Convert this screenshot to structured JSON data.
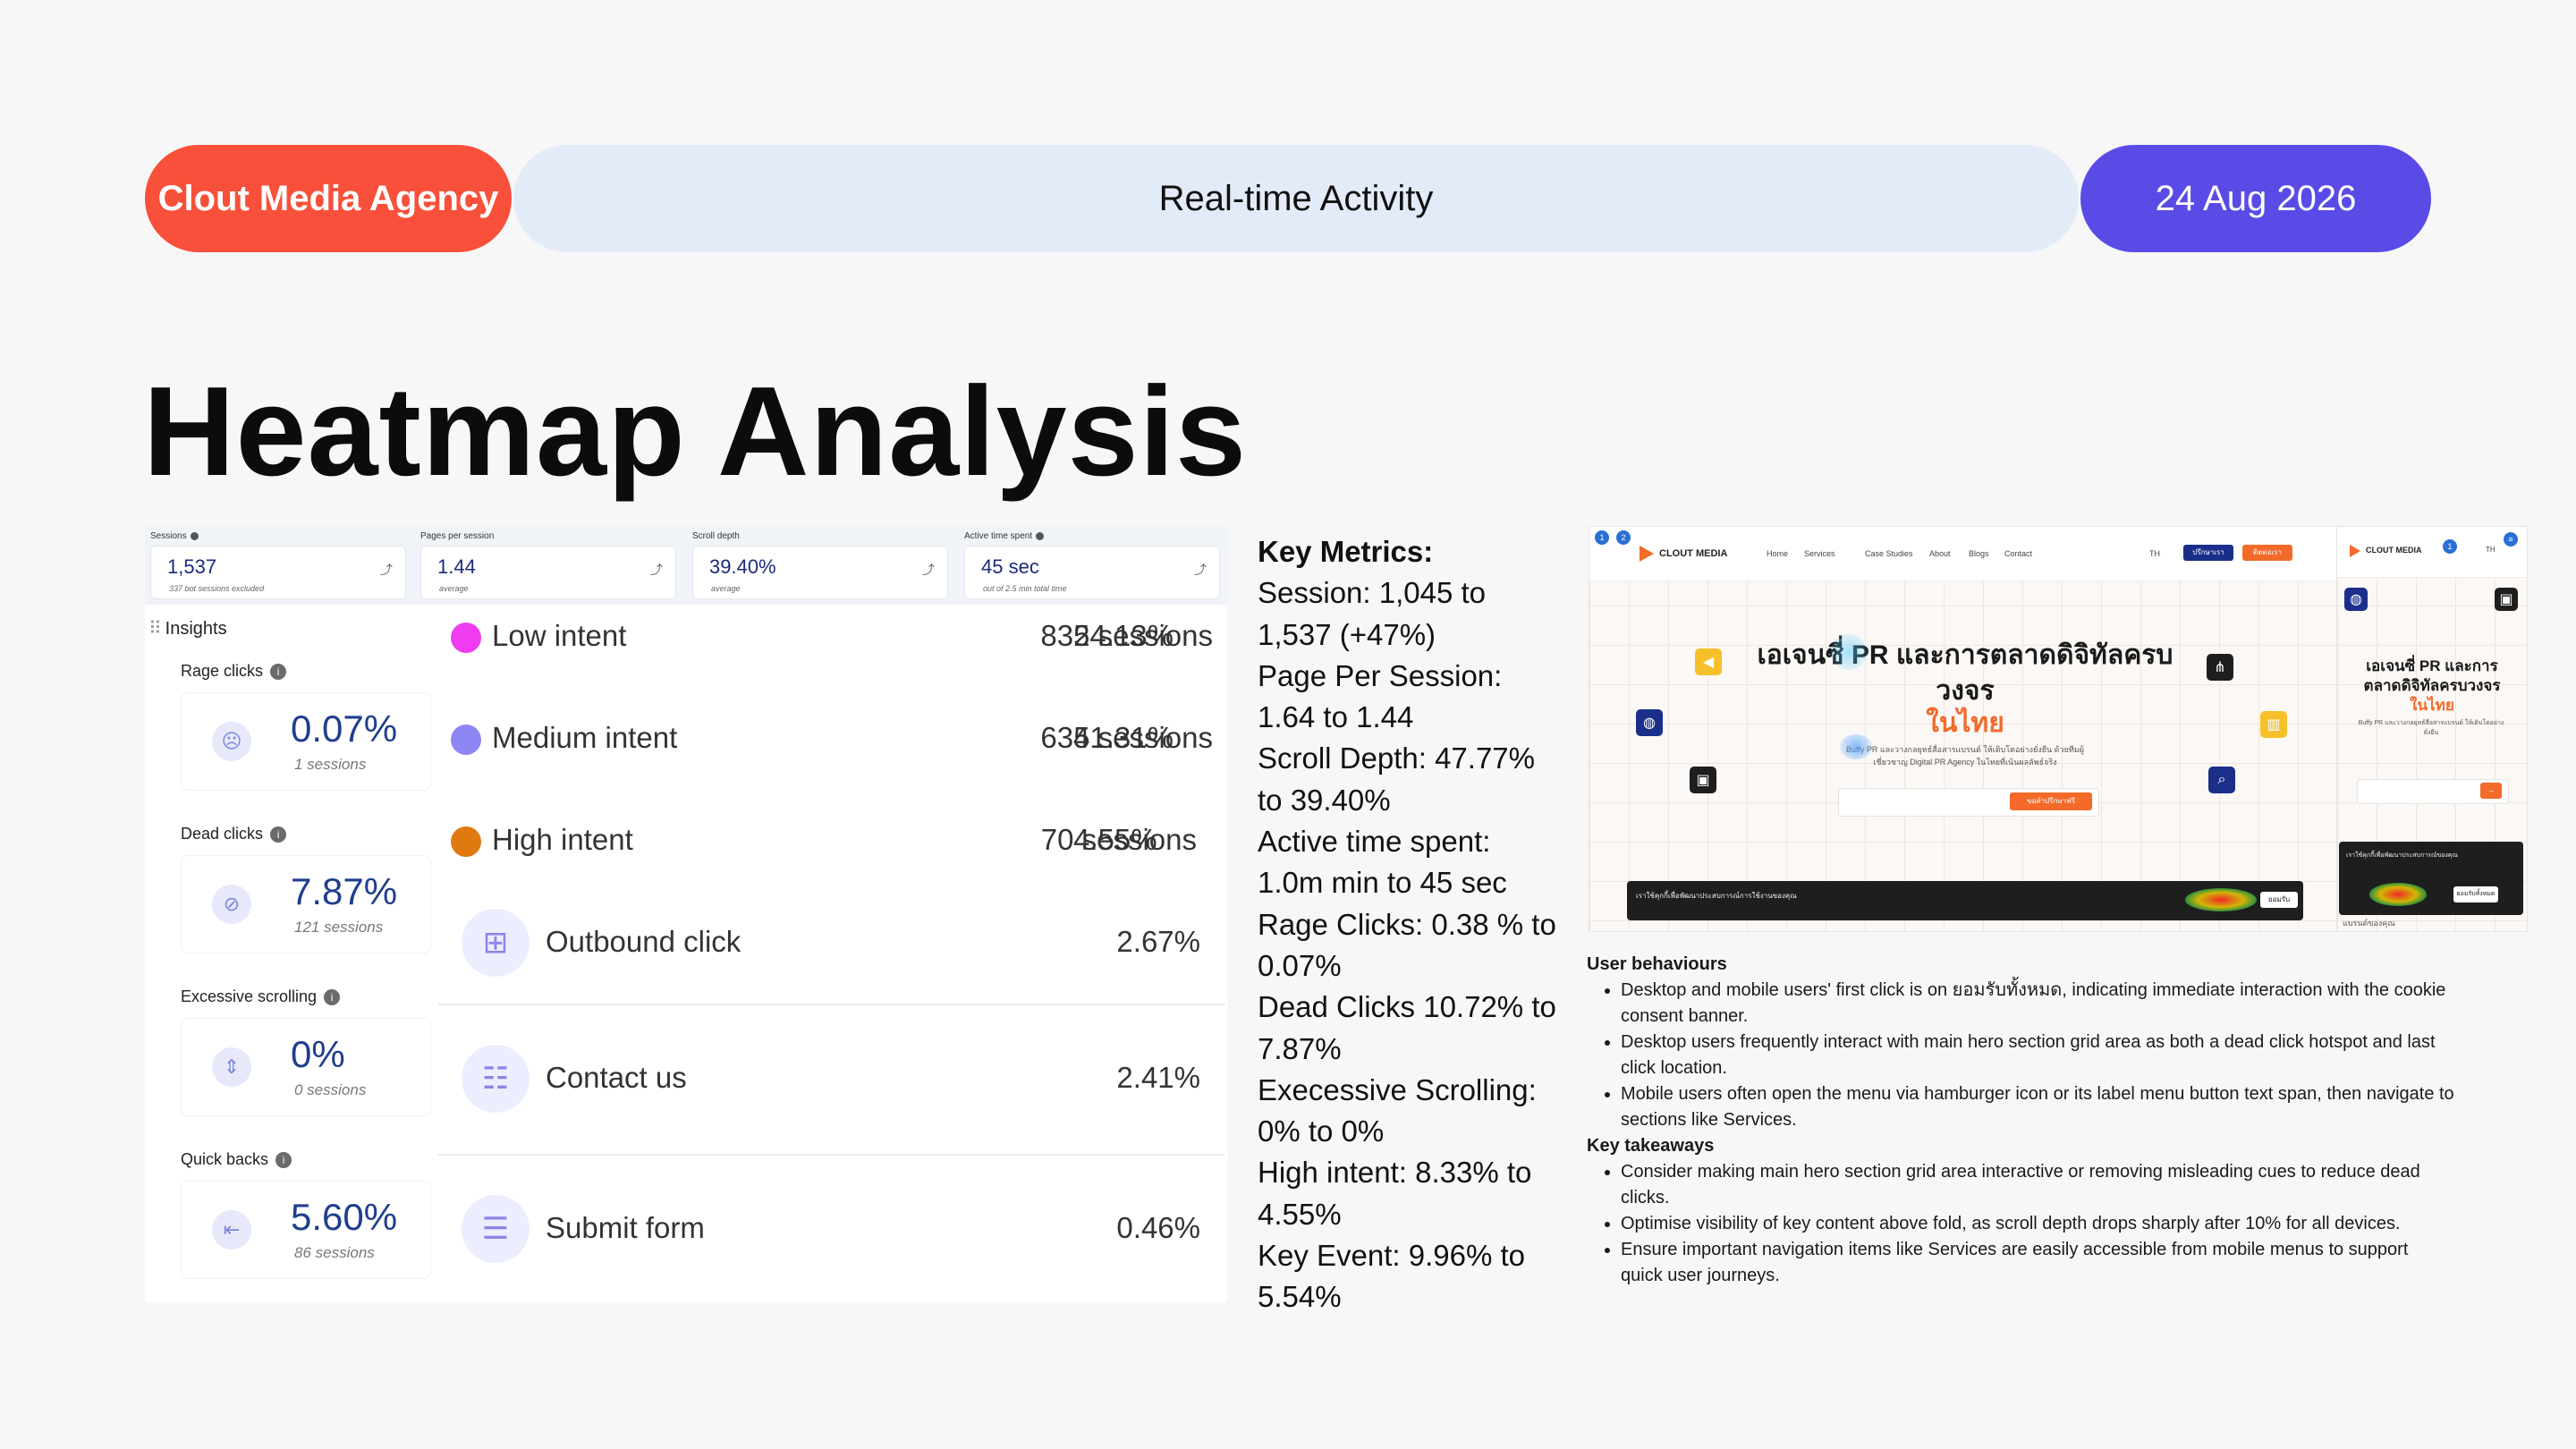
{
  "header": {
    "brand": "Clout Media Agency",
    "title": "Real-time Activity",
    "date": "24 Aug 2026",
    "colors": {
      "brand": "#f8503a",
      "title": "#e4ebf8",
      "date": "#5a4be6"
    }
  },
  "page_title": "Heatmap Analysis",
  "dashboard": {
    "kpis": [
      {
        "label": "Sessions",
        "value": "1,537",
        "sub": "337 bot sessions excluded"
      },
      {
        "label": "Pages per session",
        "value": "1.44",
        "sub": "average"
      },
      {
        "label": "Scroll depth",
        "value": "39.40%",
        "sub": "average"
      },
      {
        "label": "Active time spent",
        "value": "45 sec",
        "sub": "out of 2.5 min total time"
      }
    ],
    "insights_title": "Insights",
    "insights": [
      {
        "label": "Rage clicks",
        "value": "0.07%",
        "sub": "1 sessions",
        "icon": "angry-face-icon"
      },
      {
        "label": "Dead clicks",
        "value": "7.87%",
        "sub": "121 sessions",
        "icon": "dead-click-icon"
      },
      {
        "label": "Excessive scrolling",
        "value": "0%",
        "sub": "0 sessions",
        "icon": "scroll-icon"
      },
      {
        "label": "Quick backs",
        "value": "5.60%",
        "sub": "86 sessions",
        "icon": "back-icon"
      }
    ],
    "intents": [
      {
        "label": "Low intent",
        "pct": "54.13%",
        "sessions": "832 sessions",
        "color": "#f03bf0"
      },
      {
        "label": "Medium intent",
        "pct": "41.31%",
        "sessions": "635 sessions",
        "color": "#8f86f6"
      },
      {
        "label": "High intent",
        "pct": "4.55%",
        "sessions": "70 sessions",
        "color": "#e07a10"
      }
    ],
    "actions": [
      {
        "label": "Outbound click",
        "pct": "2.67%",
        "icon": "outbound-click-icon"
      },
      {
        "label": "Contact us",
        "pct": "2.41%",
        "icon": "contact-icon"
      },
      {
        "label": "Submit form",
        "pct": "0.46%",
        "icon": "form-icon"
      }
    ]
  },
  "key_metrics": {
    "title": "Key Metrics:",
    "lines": [
      "Session: 1,045 to 1,537 (+47%)",
      "Page Per Session: 1.64 to 1.44",
      "Scroll Depth: 47.77% to 39.40%",
      "Active time spent: 1.0m min to 45 sec",
      "Rage Clicks: 0.38 % to 0.07%",
      "Dead Clicks 10.72% to 7.87%",
      "Execessive Scrolling: 0% to 0%",
      "High intent: 8.33% to 4.55%",
      "Key Event: 9.96% to 5.54%"
    ]
  },
  "desktop_shot": {
    "logo": "CLOUT MEDIA",
    "nav": [
      "Home",
      "Services",
      "Case Studies",
      "About",
      "Blogs",
      "Contact"
    ],
    "lang": "TH",
    "btn_primary": "ปรึกษาเรา",
    "btn_secondary": "ติดต่อเรา",
    "hero_line1": "เอเจนซี่ PR และการตลาดดิจิทัลครบ",
    "hero_line2": "วงจร",
    "hero_accent": "ในไทย",
    "hero_sub": "Buffy PR และวางกลยุทธ์สื่อสารแบรนด์ ให้เติบโตอย่างยั่งยืน ด้วยทีมผู้เชี่ยวชาญ Digital PR Agency ในไทยที่เน้นผลลัพธ์จริง",
    "cta": "ขอคำปรึกษาฟรี",
    "cookie_text": "เราใช้คุกกี้เพื่อพัฒนาประสบการณ์การใช้งานของคุณ",
    "cookie_btn": "ยอมรับทั้งหมด"
  },
  "mobile_shot": {
    "logo": "CLOUT MEDIA",
    "lang": "TH",
    "hero_line1": "เอเจนซี่ PR และการ",
    "hero_line2": "ตลาดดิจิทัลครบวงจร",
    "hero_accent": "ในไทย",
    "hero_sub": "Buffy PR และวางกลยุทธ์สื่อสารแบรนด์ ให้เติบโตอย่างยั่งยืน",
    "cookie_text": "เราใช้คุกกี้เพื่อพัฒนาประสบการณ์ของคุณ",
    "cookie_btn": "ยอมรับทั้งหมด",
    "bottom_text": "แบรนด์ของคุณ"
  },
  "notes": {
    "behaviours_title": "User behaviours",
    "behaviours": [
      "Desktop and mobile users' first click is on ยอมรับทั้งหมด, indicating immediate interaction with the cookie consent banner.",
      "Desktop users frequently interact with main hero section grid area as both a dead click hotspot and last click location.",
      "Mobile users often open the menu via hamburger icon or its label menu button text span, then navigate to sections like Services."
    ],
    "takeaways_title": "Key takeaways",
    "takeaways": [
      "Consider making main hero section grid area interactive or removing misleading cues to reduce dead clicks.",
      "Optimise visibility of key content above fold, as scroll depth drops sharply after 10% for all devices.",
      "Ensure important navigation items like Services are easily accessible from mobile menus to support quick user journeys."
    ]
  }
}
